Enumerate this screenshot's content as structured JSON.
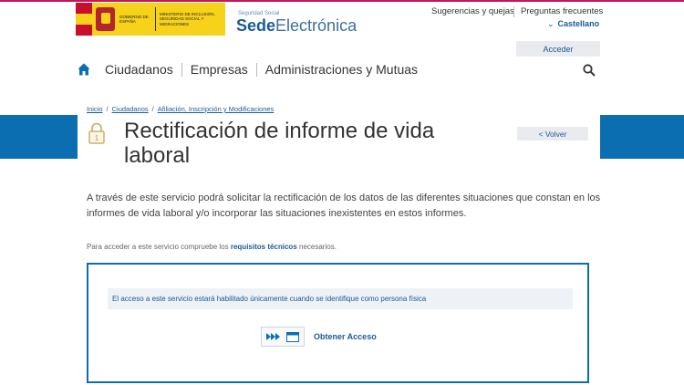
{
  "header": {
    "gov_line1": "Gobierno de España",
    "ministry": "Ministerio de Inclusión, Seguridad Social y Migraciones",
    "sede_small": "Seguridad Social",
    "sede_bold": "Sede",
    "sede_rest": "Electrónica",
    "sugerencias": "Sugerencias y quejas",
    "preguntas": "Preguntas frecuentes",
    "language": "Castellano",
    "acceder": "Acceder"
  },
  "nav": {
    "items": [
      "Ciudadanos",
      "Empresas",
      "Administraciones y Mutuas"
    ]
  },
  "breadcrumb": {
    "items": [
      "Inicio",
      "Ciudadanos",
      "Afiliación, Inscripción y Modificaciones"
    ],
    "separator": "/"
  },
  "page": {
    "title": "Rectificación de informe de vida laboral",
    "volver": "< Volver",
    "description": "A través de este servicio podrá solicitar la rectificación de los datos de las diferentes situaciones que constan en los informes de vida laboral y/o incorporar las situaciones inexistentes en estos informes.",
    "req_prefix": "Para acceder a este servicio compruebe los ",
    "req_link": "requisitos técnicos",
    "req_suffix": " necesarios."
  },
  "access": {
    "notice": "El acceso a este servicio estará habilitado únicamente cuando se identifique como persona física",
    "button": "Obtener Acceso"
  },
  "colors": {
    "primary": "#0b6eb1",
    "link": "#1a5a96",
    "accent_top": "#c2185b"
  },
  "icons": [
    "home-icon",
    "search-icon",
    "lock-icon",
    "fast-forward-icon",
    "window-icon",
    "chevron-down-icon"
  ]
}
